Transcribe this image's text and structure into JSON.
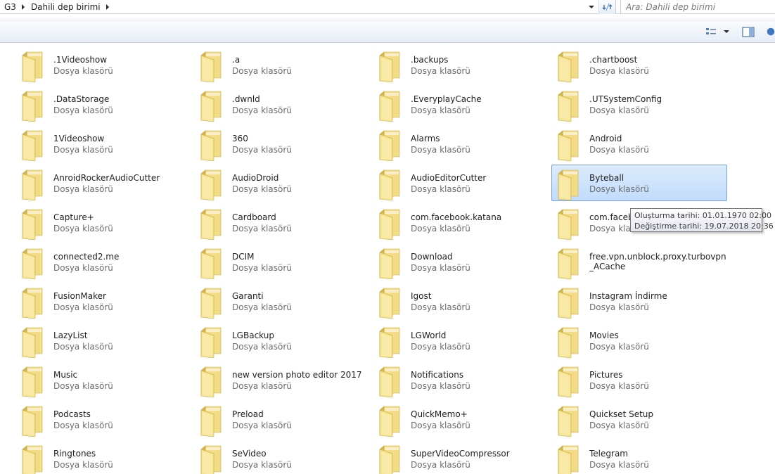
{
  "breadcrumb": [
    "G3",
    "Dahili dep birimi"
  ],
  "search": {
    "placeholder": "Ara: Dahili dep birimi"
  },
  "colors": {
    "selection": "#c9e0fc",
    "selection_border": "#7da2ce",
    "folder_yellow": "#f6e08a"
  },
  "icons": {
    "folder": "folder-icon",
    "view": "change-view-icon",
    "preview": "preview-pane-icon",
    "refresh": "refresh-icon"
  },
  "folders": [
    {
      "name": ".1Videoshow",
      "type": "Dosya klasörü"
    },
    {
      "name": ".a",
      "type": "Dosya klasörü"
    },
    {
      "name": ".backups",
      "type": "Dosya klasörü"
    },
    {
      "name": ".chartboost",
      "type": "Dosya klasörü"
    },
    {
      "name": ".DataStorage",
      "type": "Dosya klasörü"
    },
    {
      "name": ".dwnld",
      "type": "Dosya klasörü"
    },
    {
      "name": ".EveryplayCache",
      "type": "Dosya klasörü"
    },
    {
      "name": ".UTSystemConfig",
      "type": "Dosya klasörü"
    },
    {
      "name": "1Videoshow",
      "type": "Dosya klasörü"
    },
    {
      "name": "360",
      "type": "Dosya klasörü"
    },
    {
      "name": "Alarms",
      "type": "Dosya klasörü"
    },
    {
      "name": "Android",
      "type": "Dosya klasörü"
    },
    {
      "name": "AnroidRockerAudioCutter",
      "type": "Dosya klasörü"
    },
    {
      "name": "AudioDroid",
      "type": "Dosya klasörü"
    },
    {
      "name": "AudioEditorCutter",
      "type": "Dosya klasörü"
    },
    {
      "name": "Byteball",
      "type": "Dosya klasörü",
      "selected": true
    },
    {
      "name": "Capture+",
      "type": "Dosya klasörü"
    },
    {
      "name": "Cardboard",
      "type": "Dosya klasörü"
    },
    {
      "name": "com.facebook.katana",
      "type": "Dosya klasörü"
    },
    {
      "name": "com.facebook.orca",
      "type": "Dosya klasörü"
    },
    {
      "name": "connected2.me",
      "type": "Dosya klasörü"
    },
    {
      "name": "DCIM",
      "type": "Dosya klasörü"
    },
    {
      "name": "Download",
      "type": "Dosya klasörü"
    },
    {
      "name": "free.vpn.unblock.proxy.turbovpn_ACache",
      "type": "Dosya klasörü",
      "two_line": true
    },
    {
      "name": "FusionMaker",
      "type": "Dosya klasörü"
    },
    {
      "name": "Garanti",
      "type": "Dosya klasörü"
    },
    {
      "name": "Igost",
      "type": "Dosya klasörü"
    },
    {
      "name": "Instagram İndirme",
      "type": "Dosya klasörü"
    },
    {
      "name": "LazyList",
      "type": "Dosya klasörü"
    },
    {
      "name": "LGBackup",
      "type": "Dosya klasörü"
    },
    {
      "name": "LGWorld",
      "type": "Dosya klasörü"
    },
    {
      "name": "Movies",
      "type": "Dosya klasörü"
    },
    {
      "name": "Music",
      "type": "Dosya klasörü"
    },
    {
      "name": "new version photo editor 2017",
      "type": "Dosya klasörü"
    },
    {
      "name": "Notifications",
      "type": "Dosya klasörü"
    },
    {
      "name": "Pictures",
      "type": "Dosya klasörü"
    },
    {
      "name": "Podcasts",
      "type": "Dosya klasörü"
    },
    {
      "name": "Preload",
      "type": "Dosya klasörü"
    },
    {
      "name": "QuickMemo+",
      "type": "Dosya klasörü"
    },
    {
      "name": "Quickset Setup",
      "type": "Dosya klasörü"
    },
    {
      "name": "Ringtones",
      "type": "Dosya klasörü"
    },
    {
      "name": "SeVideo",
      "type": "Dosya klasörü"
    },
    {
      "name": "SuperVideoCompressor",
      "type": "Dosya klasörü"
    },
    {
      "name": "Telegram",
      "type": "Dosya klasörü"
    }
  ],
  "tooltip": {
    "created": "Oluşturma tarihi: 01.01.1970 02:00",
    "modified": "Değiştirme tarihi: 19.07.2018 20:36"
  }
}
